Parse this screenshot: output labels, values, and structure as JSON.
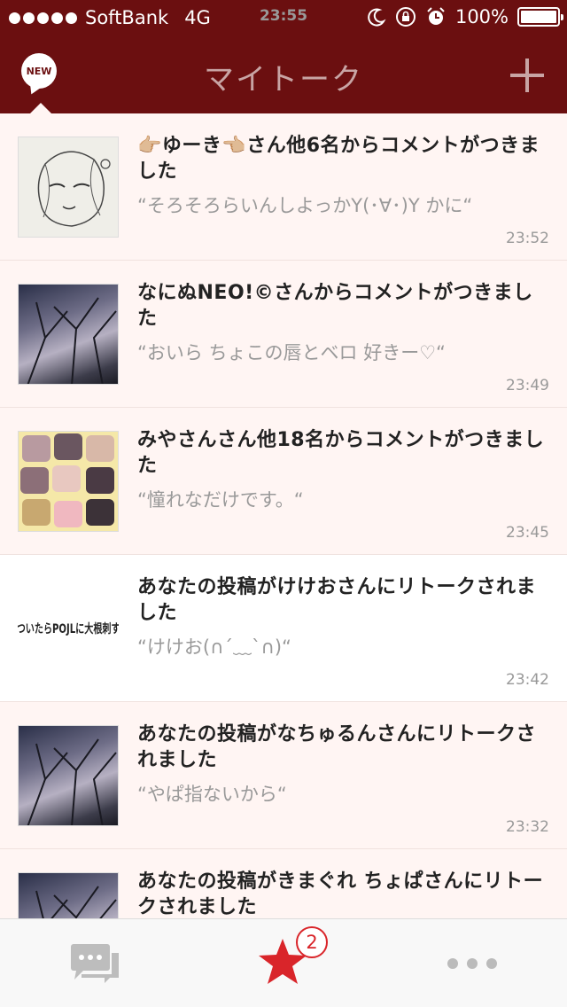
{
  "status_bar": {
    "carrier": "SoftBank",
    "network": "4G",
    "time": "23:55",
    "battery": "100%"
  },
  "nav": {
    "new_badge": "NEW",
    "title": "マイトーク"
  },
  "notifications": [
    {
      "text": "👉🏼ゆーき👈🏼さん他6名からコメントがつきました",
      "quote": "“そろそろらいんしよっかY(･∀･)Y かに“",
      "time": "23:52",
      "thumb": "sketch"
    },
    {
      "text": "なにぬNEO!©さんからコメントがつきました",
      "quote": "“おいら ちょこの唇とベロ 好きー♡“",
      "time": "23:49",
      "thumb": "tree"
    },
    {
      "text": "みやさんさん他18名からコメントがつきました",
      "quote": "“憧れなだけです。“",
      "time": "23:45",
      "thumb": "collage"
    },
    {
      "text": "あなたの投稿がけけおさんにリトークされました",
      "quote": "“けけお(∩´﹏`∩)“",
      "time": "23:42",
      "thumb": "text",
      "thumb_text": "嘘ついたらPOJLに大根刺すよ"
    },
    {
      "text": "あなたの投稿がなちゅるんさんにリトークされました",
      "quote": "“やぱ指ないから“",
      "time": "23:32",
      "thumb": "tree"
    },
    {
      "text": "あなたの投稿がきまぐれ ちょぱさんにリトークされました",
      "quote": "",
      "time": "",
      "thumb": "tree"
    }
  ],
  "tab_bar": {
    "badge_count": "2",
    "star_color": "#d9252a"
  },
  "colors": {
    "header": "#6b0f10",
    "title": "#c8a4a4",
    "unread_row": "#fff5f3"
  }
}
